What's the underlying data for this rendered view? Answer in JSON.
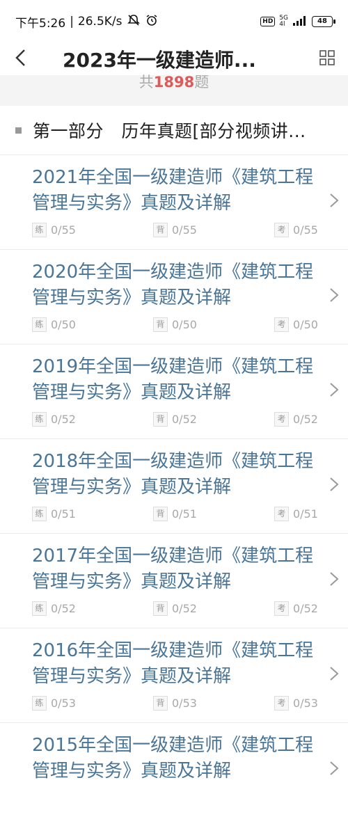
{
  "status_bar": {
    "time": "下午5:26",
    "speed": "26.5K/s",
    "hd": "HD",
    "network": "5G",
    "network_sub": "4l",
    "battery": "48"
  },
  "header": {
    "title": "2023年一级建造师..."
  },
  "count": {
    "prefix": "共",
    "number": "1898",
    "suffix": "题"
  },
  "section": {
    "title": "第一部分　历年真题[部分视频讲..."
  },
  "stat_icons": {
    "practice": "练",
    "memorize": "背",
    "exam": "考"
  },
  "items": [
    {
      "title": "2021年全国一级建造师《建筑工程管理与实务》真题及详解",
      "practice": "0/55",
      "memorize": "0/55",
      "exam": "0/55"
    },
    {
      "title": "2020年全国一级建造师《建筑工程管理与实务》真题及详解",
      "practice": "0/50",
      "memorize": "0/50",
      "exam": "0/50"
    },
    {
      "title": "2019年全国一级建造师《建筑工程管理与实务》真题及详解",
      "practice": "0/52",
      "memorize": "0/52",
      "exam": "0/52"
    },
    {
      "title": "2018年全国一级建造师《建筑工程管理与实务》真题及详解",
      "practice": "0/51",
      "memorize": "0/51",
      "exam": "0/51"
    },
    {
      "title": "2017年全国一级建造师《建筑工程管理与实务》真题及详解",
      "practice": "0/52",
      "memorize": "0/52",
      "exam": "0/52"
    },
    {
      "title": "2016年全国一级建造师《建筑工程管理与实务》真题及详解",
      "practice": "0/53",
      "memorize": "0/53",
      "exam": "0/53"
    },
    {
      "title": "2015年全国一级建造师《建筑工程管理与实务》真题及详解"
    }
  ],
  "colors": {
    "title_blue": "#4a7597",
    "count_red": "#e05858",
    "stat_gray": "#a8a8a8"
  },
  "icons": {
    "back": "chevron-left-icon",
    "grid": "grid-icon",
    "item_arrow": "chevron-right-icon",
    "section_bullet": "square-bullet-icon"
  }
}
